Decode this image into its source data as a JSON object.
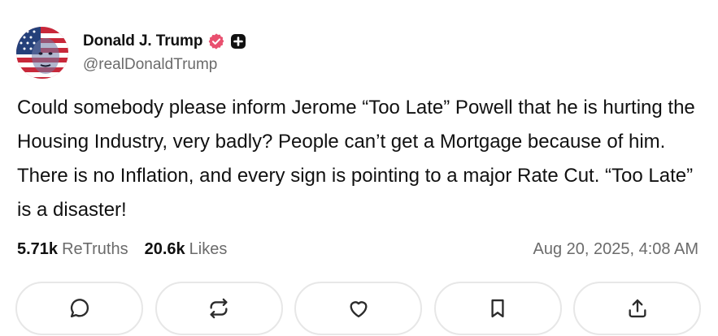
{
  "author": {
    "display_name": "Donald J. Trump",
    "handle": "@realDonaldTrump",
    "verified_icon": "verified-badge-icon",
    "plus_icon": "plus-badge-icon",
    "verified_color": "#e9506f"
  },
  "post": {
    "text": "Could somebody please inform Jerome “Too Late” Powell that he is hurting the Housing Industry, very badly? People can’t get a Mortgage because of him. There is no Inflation, and every sign is pointing to a major Rate Cut. “Too Late” is a disaster!"
  },
  "stats": {
    "retruths_count": "5.71k",
    "retruths_label": "ReTruths",
    "likes_count": "20.6k",
    "likes_label": "Likes",
    "timestamp": "Aug 20, 2025, 4:08 AM"
  },
  "actions": [
    {
      "icon": "reply-icon"
    },
    {
      "icon": "retruth-icon"
    },
    {
      "icon": "like-icon"
    },
    {
      "icon": "bookmark-icon"
    },
    {
      "icon": "share-icon"
    }
  ]
}
